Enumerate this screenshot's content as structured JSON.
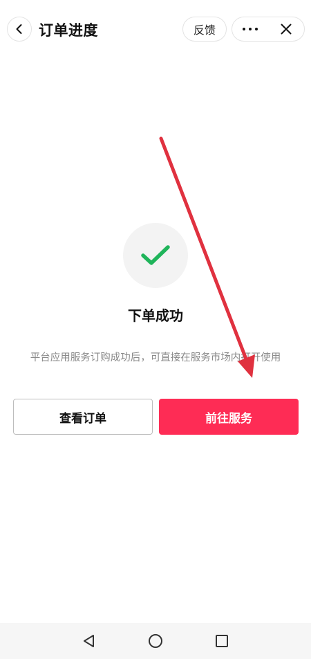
{
  "header": {
    "title": "订单进度",
    "feedback_label": "反馈",
    "back_icon": "chevron-left-icon",
    "more_icon": "more-dots-icon",
    "close_icon": "close-icon"
  },
  "result": {
    "status_icon": "check-icon",
    "title": "下单成功",
    "description": "平台应用服务订购成功后，可直接在服务市场内打开使用"
  },
  "actions": {
    "view_order_label": "查看订单",
    "go_service_label": "前往服务"
  },
  "colors": {
    "accent": "#fe2c55",
    "check": "#1fb45a",
    "annotation_arrow": "#e0313f"
  },
  "system_nav": {
    "back_icon": "triangle-back-icon",
    "home_icon": "circle-home-icon",
    "recents_icon": "square-recents-icon"
  }
}
